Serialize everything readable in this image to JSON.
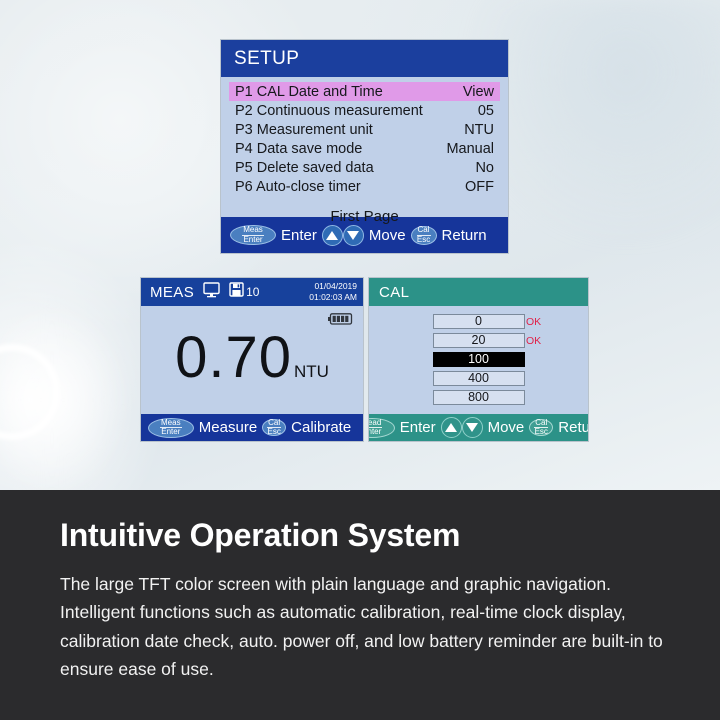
{
  "setup": {
    "title": "SETUP",
    "rows": [
      {
        "label": "P1 CAL Date and Time",
        "value": "View",
        "selected": true
      },
      {
        "label": "P2 Continuous measurement",
        "value": "05",
        "selected": false
      },
      {
        "label": "P3 Measurement unit",
        "value": "NTU",
        "selected": false
      },
      {
        "label": "P4 Data  save mode",
        "value": "Manual",
        "selected": false
      },
      {
        "label": "P5 Delete  saved data",
        "value": "No",
        "selected": false
      },
      {
        "label": "P6 Auto-close timer",
        "value": "OFF",
        "selected": false
      }
    ],
    "page_label": "First Page",
    "footer": {
      "key1_line1": "Meas",
      "key1_line2": "Enter",
      "action1": "Enter",
      "action2": "Move",
      "key2_line1": "Cal",
      "key2_line2": "Esc",
      "action3": "Return"
    },
    "header_color": "#1b3f9e",
    "highlight_color": "#e09ae8"
  },
  "meas": {
    "title": "MEAS",
    "monitor_icon": "monitor-icon",
    "save_icon": "floppy-save-icon",
    "save_count": "10",
    "date": "01/04/2019",
    "time": "01:02:03 AM",
    "battery_icon": "battery-full-icon",
    "value": "0.70",
    "unit": "NTU",
    "footer": {
      "key1_line1": "Meas",
      "key1_line2": "Enter",
      "action1": "Measure",
      "key2_line1": "Cal",
      "key2_line2": "Esc",
      "action2": "Calibrate"
    },
    "header_color": "#17419c"
  },
  "cal": {
    "title": "CAL",
    "standards": [
      {
        "value": "0",
        "status": "OK",
        "selected": false
      },
      {
        "value": "20",
        "status": "OK",
        "selected": false
      },
      {
        "value": "100",
        "status": "",
        "selected": true
      },
      {
        "value": "400",
        "status": "",
        "selected": false
      },
      {
        "value": "800",
        "status": "",
        "selected": false
      }
    ],
    "footer": {
      "key1_line1": "Read",
      "key1_line2": "Enter",
      "action1": "Enter",
      "action2": "Move",
      "key2_line1": "Cal",
      "key2_line2": "Esc",
      "action3": "Return"
    },
    "header_color": "#2c9288",
    "ok_color": "#e0224a"
  },
  "promo": {
    "heading": "Intuitive Operation System",
    "body": "The large TFT color screen with plain language and graphic navigation. Intelligent functions such as automatic calibration, real-time clock display, calibration date check, auto. power off, and low battery reminder are built-in to ensure ease of use.",
    "background_color": "#2b2b2d"
  }
}
